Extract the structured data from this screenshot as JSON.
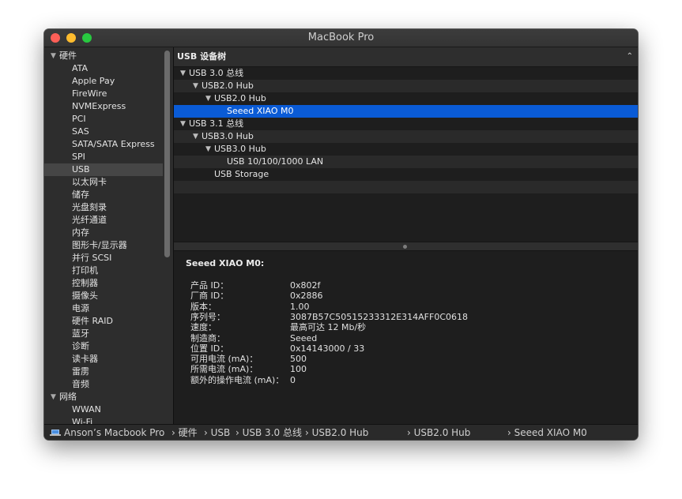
{
  "window": {
    "title": "MacBook Pro"
  },
  "sidebar": {
    "items": [
      {
        "label": "硬件",
        "type": "group"
      },
      {
        "label": "ATA"
      },
      {
        "label": "Apple Pay"
      },
      {
        "label": "FireWire"
      },
      {
        "label": "NVMExpress"
      },
      {
        "label": "PCI"
      },
      {
        "label": "SAS"
      },
      {
        "label": "SATA/SATA Express"
      },
      {
        "label": "SPI"
      },
      {
        "label": "USB",
        "selected": true
      },
      {
        "label": "以太网卡"
      },
      {
        "label": "储存"
      },
      {
        "label": "光盘刻录"
      },
      {
        "label": "光纤通道"
      },
      {
        "label": "内存"
      },
      {
        "label": "图形卡/显示器"
      },
      {
        "label": "并行 SCSI"
      },
      {
        "label": "打印机"
      },
      {
        "label": "控制器"
      },
      {
        "label": "摄像头"
      },
      {
        "label": "电源"
      },
      {
        "label": "硬件 RAID"
      },
      {
        "label": "蓝牙"
      },
      {
        "label": "诊断"
      },
      {
        "label": "读卡器"
      },
      {
        "label": "雷雳"
      },
      {
        "label": "音频"
      },
      {
        "label": "网络",
        "type": "group"
      },
      {
        "label": "WWAN"
      },
      {
        "label": "Wi-Fi"
      }
    ]
  },
  "tree": {
    "header": "USB 设备树",
    "rows": [
      {
        "label": "USB 3.0 总线",
        "level": 0,
        "expanded": true
      },
      {
        "label": "USB2.0 Hub",
        "level": 1,
        "expanded": true
      },
      {
        "label": "USB2.0 Hub",
        "level": 2,
        "expanded": true
      },
      {
        "label": "Seeed XIAO M0",
        "level": 3,
        "selected": true
      },
      {
        "label": "USB 3.1 总线",
        "level": 0,
        "expanded": true
      },
      {
        "label": "USB3.0 Hub",
        "level": 1,
        "expanded": true
      },
      {
        "label": "USB3.0 Hub",
        "level": 2,
        "expanded": true
      },
      {
        "label": "USB 10/100/1000 LAN",
        "level": 3
      },
      {
        "label": "USB Storage",
        "level": 2
      }
    ]
  },
  "detail": {
    "title": "Seeed XIAO M0:",
    "fields": [
      {
        "key": "产品 ID：",
        "value": "0x802f"
      },
      {
        "key": "厂商 ID：",
        "value": "0x2886"
      },
      {
        "key": "版本：",
        "value": "1.00"
      },
      {
        "key": "序列号：",
        "value": "3087B57C50515233312E314AFF0C0618"
      },
      {
        "key": "速度：",
        "value": "最高可达 12 Mb/秒"
      },
      {
        "key": "制造商：",
        "value": "Seeed"
      },
      {
        "key": "位置 ID：",
        "value": "0x14143000 / 33"
      },
      {
        "key": "可用电流 (mA)：",
        "value": "500"
      },
      {
        "key": "所需电流 (mA)：",
        "value": "100"
      },
      {
        "key": "额外的操作电流 (mA)：",
        "value": "0"
      }
    ]
  },
  "statusbar": {
    "icon": "laptop-icon",
    "crumbs": [
      "Anson’s Macbook Pro",
      "硬件",
      "USB",
      "USB 3.0 总线",
      "USB2.0 Hub",
      "USB2.0 Hub",
      "Seeed XIAO M0"
    ]
  },
  "colors": {
    "selection": "#0a5bd6",
    "close": "#fe5f57",
    "minimize": "#febc2e",
    "maximize": "#28c840"
  }
}
